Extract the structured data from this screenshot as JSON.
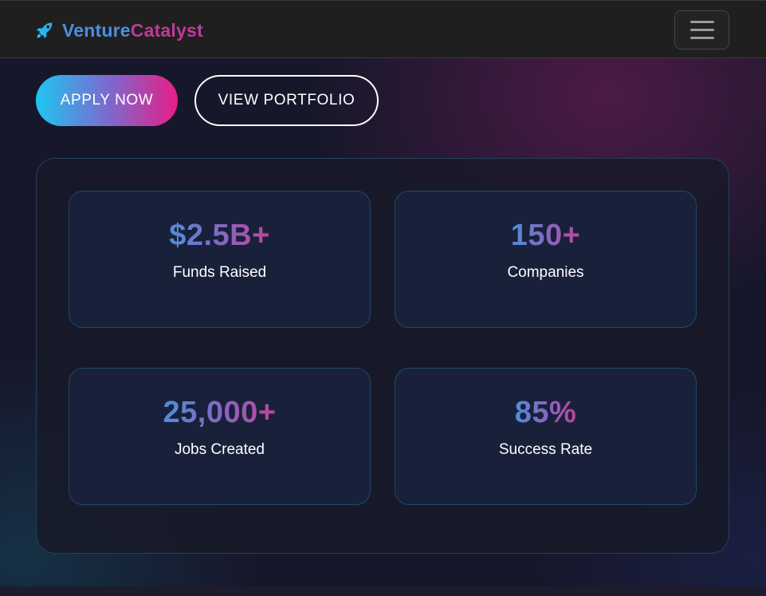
{
  "brand": {
    "name_part1": "Venture",
    "name_part2": "Catalyst",
    "icon": "rocket-icon",
    "colors": {
      "part1": "#4b8fe0",
      "part2": "#c03a9a"
    }
  },
  "navbar": {
    "menu_icon": "hamburger-menu-icon"
  },
  "hero": {
    "apply_label": "APPLY NOW",
    "portfolio_label": "VIEW PORTFOLIO"
  },
  "stats": [
    {
      "value": "$2.5B+",
      "label": "Funds Raised"
    },
    {
      "value": "150+",
      "label": "Companies"
    },
    {
      "value": "25,000+",
      "label": "Jobs Created"
    },
    {
      "value": "85%",
      "label": "Success Rate"
    }
  ],
  "colors": {
    "accent_gradient_start": "#1ec6f0",
    "accent_gradient_end": "#e61f86",
    "background": "#17172b",
    "navbar": "#1f1f1f"
  }
}
